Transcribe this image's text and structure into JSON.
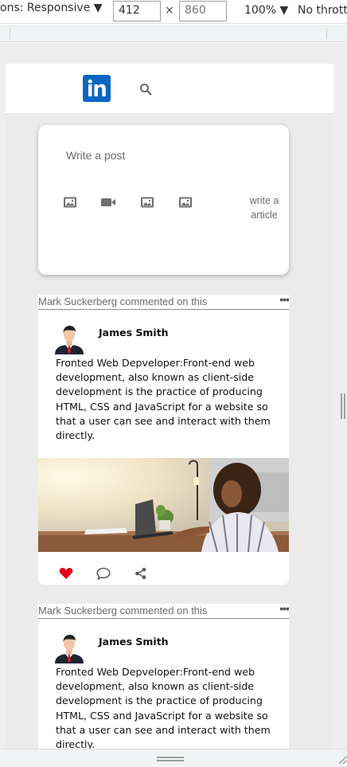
{
  "devtools": {
    "dimensions_label": "ons: Responsive",
    "dimensions_arrow": "▼",
    "width_value": "412",
    "times": "×",
    "height_value": "860",
    "zoom_label": "100%",
    "zoom_arrow": "▼",
    "throttle_label": "No thrott"
  },
  "navbar": {
    "logo_text": "in",
    "logo_color": "#0a66c2",
    "search_icon": "search-icon"
  },
  "composer": {
    "placeholder": "Write a post",
    "media_icons": [
      "image-icon",
      "video-icon",
      "image-icon",
      "image-icon"
    ],
    "write_article_label": "write a article"
  },
  "posts": [
    {
      "activity": "Mark Suckerberg commented on this",
      "more": "•••",
      "author": "James Smith",
      "text": "Fronted Web Depveloper:Front-end web development, also known as client-side development is the practice of producing HTML, CSS and JavaScript for a website so that a user can see and interact with them directly.",
      "liked": true,
      "like_color": "#e0001b",
      "actions": [
        "heart-icon",
        "comment-icon",
        "share-icon"
      ]
    },
    {
      "activity": "Mark Suckerberg commented on this",
      "more": "•••",
      "author": "James Smith",
      "text": "Fronted Web Depveloper:Front-end web development, also known as client-side development is the practice of producing HTML, CSS and JavaScript for a website so that a user can see and interact with them directly."
    }
  ]
}
